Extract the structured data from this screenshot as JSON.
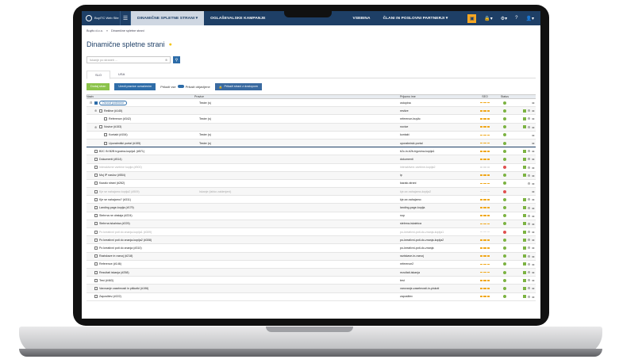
{
  "nav": {
    "logo": "BuyITC Web Site",
    "menu": "☰",
    "items": [
      "DINAMIČNE SPLETNE STRANI ▾",
      "OGLAŠEVALSKE KAMPANJE",
      "VSEBINA",
      "ČLANI IN POSLOVNI PARTNERJI ▾"
    ],
    "right": [
      "🔒▾",
      "⚙▾",
      "?",
      "👤▾"
    ]
  },
  "breadcrumb": [
    "Buyitc d.o.o.",
    "»",
    "Dinamične spletne strani"
  ],
  "page": {
    "title": "Dinamične spletne strani"
  },
  "search": {
    "placeholder": "Iskanje po straneh ..."
  },
  "tabs": [
    "SLO",
    "USA"
  ],
  "actions": {
    "new": "Dodaj stran",
    "sort": "Uredi pravice označenim",
    "show_all": "Prikaži vse",
    "show_public": "Prikaži objavljene",
    "access": "Prikaži strani z dostopom"
  },
  "headers": {
    "name": "Naziv",
    "rights": "Pravice",
    "slug": "Prijazno ime",
    "seo": "SEO",
    "status": "Status"
  },
  "rows": [
    {
      "name": "Osnovi podmene",
      "indent": 0,
      "exp": "⊟",
      "checked": true,
      "pill": true,
      "rights": "Tester (s)",
      "slug": "ostopina",
      "seo": "o",
      "status": "g",
      "lock": false
    },
    {
      "name": "Rešitve (#145)",
      "indent": 1,
      "exp": "⊕",
      "rights": "",
      "slug": "resitve",
      "seo": "o",
      "status": "g",
      "lock": true,
      "ok": true
    },
    {
      "name": "Reference (#342)",
      "indent": 2,
      "exp": "",
      "rights": "Tester (s)",
      "slug": "reference-buyitc",
      "seo": "o",
      "status": "g",
      "lock": false,
      "ok": true
    },
    {
      "name": "Novice (#153)",
      "indent": 1,
      "exp": "⊕",
      "rights": "",
      "slug": "novice",
      "seo": "o",
      "status": "g",
      "lock": true,
      "ok": true
    },
    {
      "name": "Kontakt (#154)",
      "indent": 2,
      "exp": "",
      "rights": "Tester (s)",
      "slug": "kontakt",
      "seo": "o",
      "status": "g",
      "lock": false
    },
    {
      "name": "Uporabniški portal (#155)",
      "indent": 2,
      "exp": "",
      "rights": "Tester (s)",
      "slug": "uporabniski-portal",
      "seo": "o",
      "status": "g",
      "lock": false,
      "sep": true
    },
    {
      "name": "B2C IN B2B trgovina-kopija1 (#571)",
      "indent": 0,
      "exp": "",
      "rights": "",
      "slug": "b2c-in-b2b-trgovina-kopija1",
      "seo": "o",
      "status": "g",
      "lock": true,
      "ok": true
    },
    {
      "name": "Dokumenti (#514)",
      "indent": 0,
      "exp": "",
      "rights": "",
      "slug": "dokumenti",
      "seo": "o",
      "status": "g",
      "lock": true,
      "ok": true
    },
    {
      "name": "Interaktivne vsebine kopija (#500)",
      "indent": 0,
      "exp": "",
      "rights": "",
      "slug": "interaktivne-vsebine-kopija2",
      "seo": "g",
      "status": "r",
      "lock": true,
      "dim": true,
      "ok": true
    },
    {
      "name": "Moj IP naslov (#554)",
      "indent": 0,
      "exp": "",
      "rights": "",
      "slug": "ip",
      "seo": "o",
      "status": "g",
      "lock": true,
      "ok": true
    },
    {
      "name": "Kazalo strani (#262)",
      "indent": 0,
      "exp": "",
      "rights": "",
      "slug": "kazalo-strani",
      "seo": "o",
      "status": "g",
      "lock": true
    },
    {
      "name": "Kje se nahajamo kopija2 (#509)",
      "indent": 0,
      "exp": "",
      "rights": "Iskanje (lahko zaklenjeni)",
      "slug": "kje-se-nahajamo-kopija2",
      "seo": "g",
      "status": "r",
      "lock": false,
      "dim": true
    },
    {
      "name": "Kje se nahajamo? (#311)",
      "indent": 0,
      "exp": "",
      "rights": "",
      "slug": "kje-se-nahajamo",
      "seo": "o",
      "status": "g",
      "lock": true,
      "ok": true
    },
    {
      "name": "Landing page-kopija (#179)",
      "indent": 0,
      "exp": "",
      "rights": "",
      "slug": "landing-page-kopija",
      "seo": "o",
      "status": "g",
      "lock": true,
      "ok": true
    },
    {
      "name": "Stebrna ne obstaja (#224)",
      "indent": 0,
      "exp": "",
      "rights": "",
      "slug": "nop",
      "seo": "o",
      "status": "g",
      "lock": true,
      "ok": true
    },
    {
      "name": "Stebrna iskalnica (#225)",
      "indent": 0,
      "exp": "",
      "rights": "",
      "slug": "stebrna-iskalnica",
      "seo": "o",
      "status": "g",
      "lock": true,
      "ok": true
    },
    {
      "name": "Po kreativni poti do znanja-kopija1 (#309)",
      "indent": 0,
      "exp": "",
      "rights": "",
      "slug": "po-kreativni-poti-do-znanja-kopija1",
      "seo": "g",
      "status": "r",
      "lock": true,
      "dim": true,
      "ok": true
    },
    {
      "name": "Po kreativni poti do znanja-kopija2 (#308)",
      "indent": 0,
      "exp": "",
      "rights": "",
      "slug": "po-kreativni-poti-do-znanja-kopija2",
      "seo": "o",
      "status": "g",
      "lock": true,
      "ok": true
    },
    {
      "name": "Po kreativni poti do znanja (#310)",
      "indent": 0,
      "exp": "",
      "rights": "",
      "slug": "po-kreativni-poti-do-znanja",
      "seo": "o",
      "status": "g",
      "lock": true,
      "ok": true
    },
    {
      "name": "Raziskave in razvoj (#218)",
      "indent": 0,
      "exp": "",
      "rights": "",
      "slug": "raziskave-in-razvoj",
      "seo": "o",
      "status": "g",
      "lock": true,
      "ok": true
    },
    {
      "name": "Reference (#146)",
      "indent": 0,
      "exp": "",
      "rights": "",
      "slug": "reference2",
      "seo": "o",
      "status": "g",
      "lock": true,
      "ok": true
    },
    {
      "name": "Rezultati iskanja (#258)",
      "indent": 0,
      "exp": "",
      "rights": "",
      "slug": "rezultati-iskanja",
      "seo": "o",
      "status": "g",
      "lock": true,
      "ok": true
    },
    {
      "name": "Test (#463)",
      "indent": 0,
      "exp": "",
      "rights": "",
      "slug": "test",
      "seo": "o",
      "status": "g",
      "lock": true,
      "ok": true
    },
    {
      "name": "Varovanje zasebnosti in piškotki (#196)",
      "indent": 0,
      "exp": "",
      "rights": "",
      "slug": "varovanje-zasebnosti-in-piskoti",
      "seo": "o",
      "status": "g",
      "lock": true,
      "ok": true
    },
    {
      "name": "Zaposlitev (#222)",
      "indent": 0,
      "exp": "",
      "rights": "",
      "slug": "zaposlitev",
      "seo": "o",
      "status": "g",
      "lock": true,
      "ok": true
    }
  ]
}
